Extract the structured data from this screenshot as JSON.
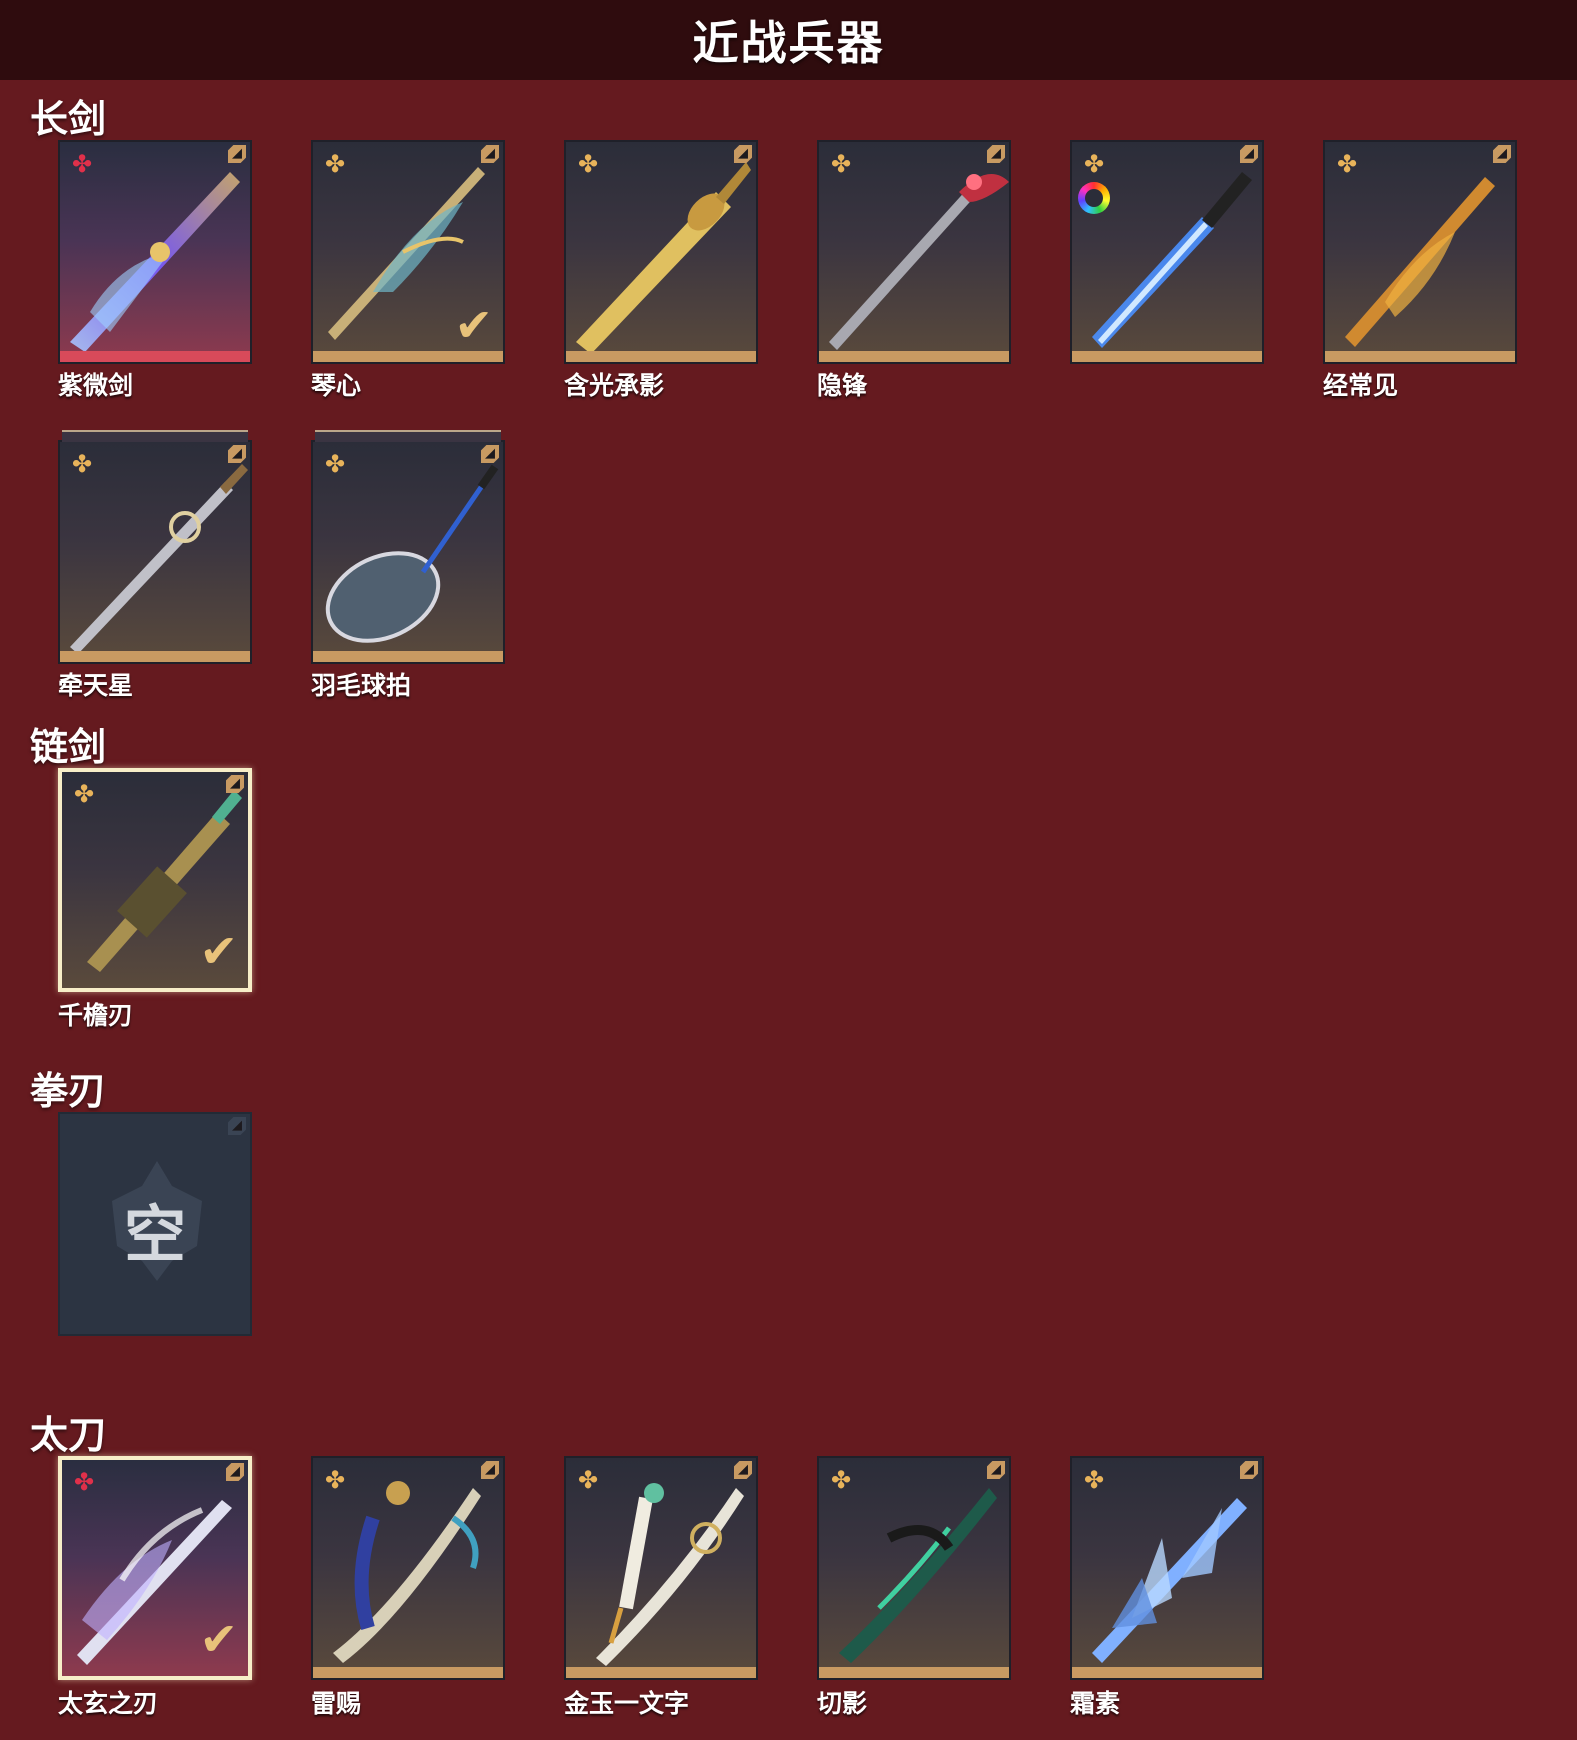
{
  "header": {
    "title": "近战兵器"
  },
  "sections": [
    {
      "label": "长剑",
      "items": [
        {
          "name": "紫微剑",
          "rank_icon": "red-star-icon",
          "selected": false
        },
        {
          "name": "琴心",
          "rank_icon": "gold-star-icon",
          "equipped": true
        },
        {
          "name": "含光承影",
          "rank_icon": "gold-star-icon"
        },
        {
          "name": "隐锋",
          "rank_icon": "gold-star-icon"
        },
        {
          "name": "",
          "rank_icon": "gold-star-icon",
          "extra_icon": "color-wheel-icon"
        },
        {
          "name": "经常见",
          "rank_icon": "gold-star-icon"
        },
        {
          "name": "牵天星",
          "rank_icon": "gold-star-icon"
        },
        {
          "name": "羽毛球拍",
          "rank_icon": "gold-star-icon"
        }
      ]
    },
    {
      "label": "链剑",
      "items": [
        {
          "name": "千檐刃",
          "rank_icon": "gold-star-icon",
          "equipped": true,
          "selected": true
        }
      ]
    },
    {
      "label": "拳刃",
      "items": [
        {
          "name": "",
          "empty_text": "空"
        }
      ]
    },
    {
      "label": "太刀",
      "items": [
        {
          "name": "太玄之刃",
          "rank_icon": "red-star-icon",
          "equipped": true,
          "selected": true
        },
        {
          "name": "雷赐",
          "rank_icon": "gold-star-icon"
        },
        {
          "name": "金玉一文字",
          "rank_icon": "gold-star-icon"
        },
        {
          "name": "切影",
          "rank_icon": "gold-star-icon"
        },
        {
          "name": "霜素",
          "rank_icon": "gold-star-icon"
        }
      ]
    }
  ],
  "colors": {
    "background": "#651a1f",
    "header_bg": "#2f0c0e",
    "gold_accent": "#c89a62",
    "red_accent": "#d84a5a",
    "selected_border": "#f7eec8"
  }
}
